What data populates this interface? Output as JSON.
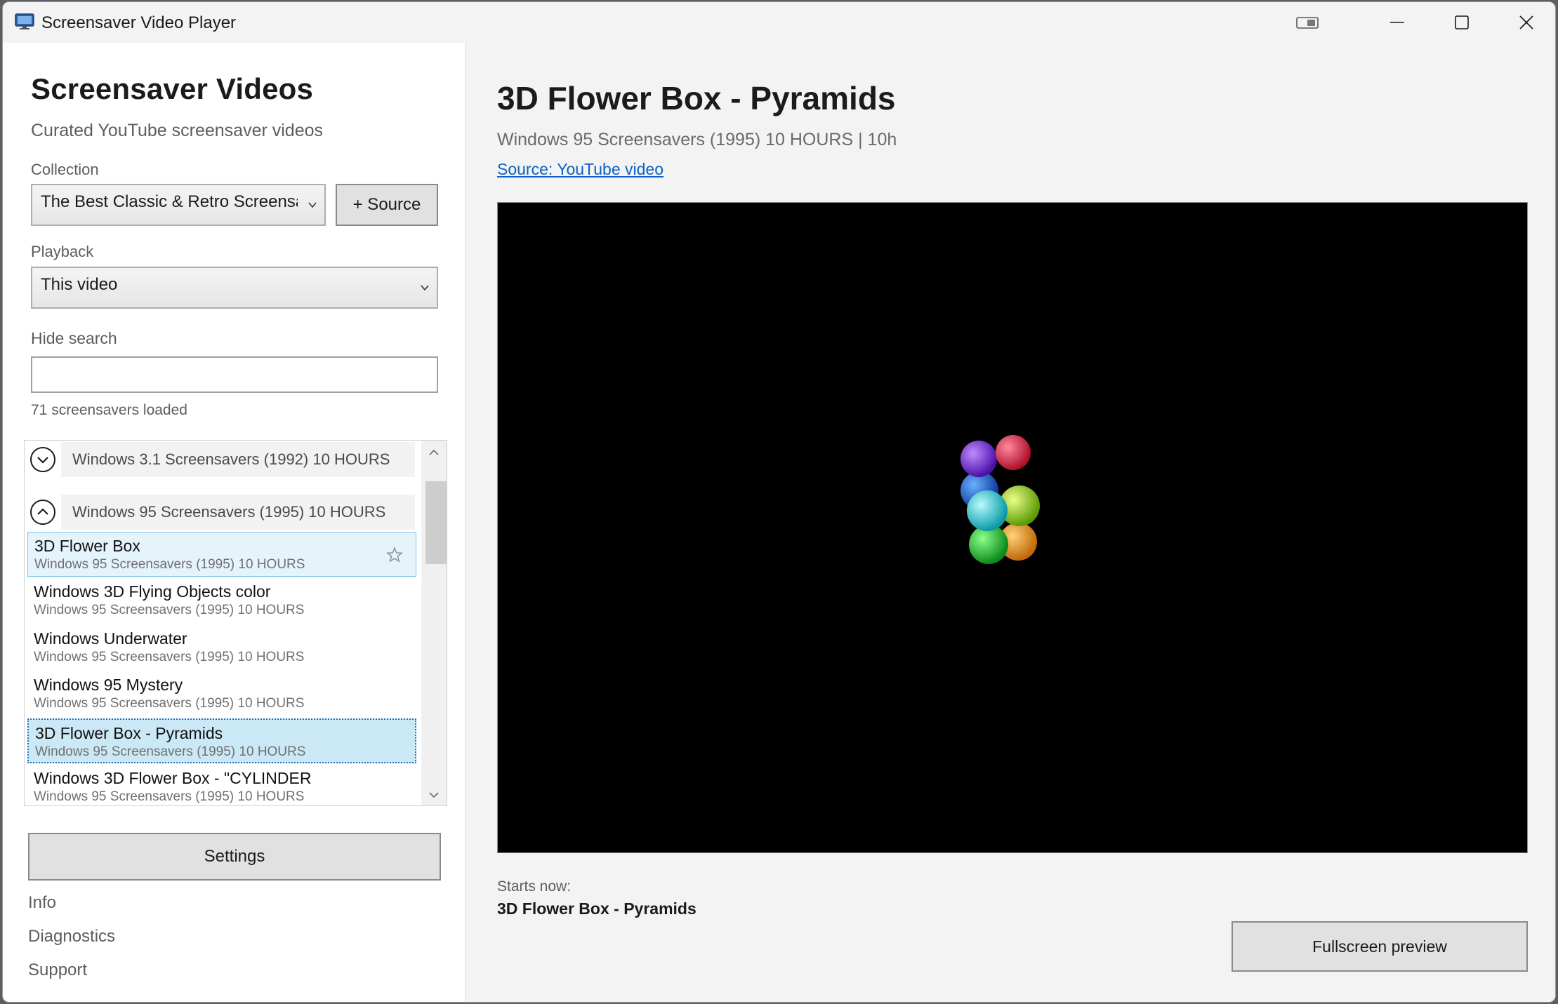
{
  "window": {
    "title": "Screensaver Video Player"
  },
  "sidebar": {
    "title": "Screensaver Videos",
    "subtitle": "Curated YouTube screensaver videos",
    "collection_label": "Collection",
    "collection_value": "The Best Classic & Retro Screensavers",
    "add_source_label": "+ Source",
    "playback_label": "Playback",
    "playback_value": "This video",
    "search_label": "Hide search",
    "search_value": "",
    "loaded_count": "71 screensavers loaded",
    "groups": [
      {
        "label": "Windows 3.1 Screensavers (1992) 10 HOURS",
        "expanded": false
      },
      {
        "label": "Windows 95 Screensavers (1995) 10 HOURS",
        "expanded": true
      }
    ],
    "items": [
      {
        "title": "3D Flower Box",
        "subtitle": "Windows 95 Screensavers (1995) 10 HOURS",
        "state": "hover"
      },
      {
        "title": "Windows 3D Flying Objects color",
        "subtitle": "Windows 95 Screensavers (1995) 10 HOURS",
        "state": ""
      },
      {
        "title": "Windows Underwater",
        "subtitle": "Windows 95 Screensavers (1995) 10 HOURS",
        "state": ""
      },
      {
        "title": "Windows 95 Mystery",
        "subtitle": "Windows 95 Screensavers (1995) 10 HOURS",
        "state": ""
      },
      {
        "title": "3D Flower Box - Pyramids",
        "subtitle": "Windows 95 Screensavers (1995) 10 HOURS",
        "state": "selected"
      },
      {
        "title": "Windows 3D Flower Box - \"CYLINDER",
        "subtitle": "Windows 95 Screensavers (1995) 10 HOURS",
        "state": ""
      }
    ],
    "settings_label": "Settings",
    "links": [
      "Info",
      "Diagnostics",
      "Support"
    ]
  },
  "main": {
    "title": "3D Flower Box - Pyramids",
    "subtitle": "Windows 95 Screensavers (1995) 10 HOURS | 10h",
    "source_link": "Source: YouTube video",
    "starts_label": "Starts now:",
    "starts_value": "3D Flower Box - Pyramids",
    "fullscreen_label": "Fullscreen preview"
  },
  "colors": {
    "accent_link": "#0b62c4",
    "selection_bg": "#cbe8f6",
    "hover_bg": "#e5f3fb",
    "video_bg": "#000000"
  },
  "icons": [
    "app-monitor-icon",
    "snap-layout-icon",
    "minimize-icon",
    "maximize-icon",
    "close-icon",
    "chevron-down-icon",
    "star-icon",
    "scroll-up-icon",
    "scroll-down-icon"
  ]
}
